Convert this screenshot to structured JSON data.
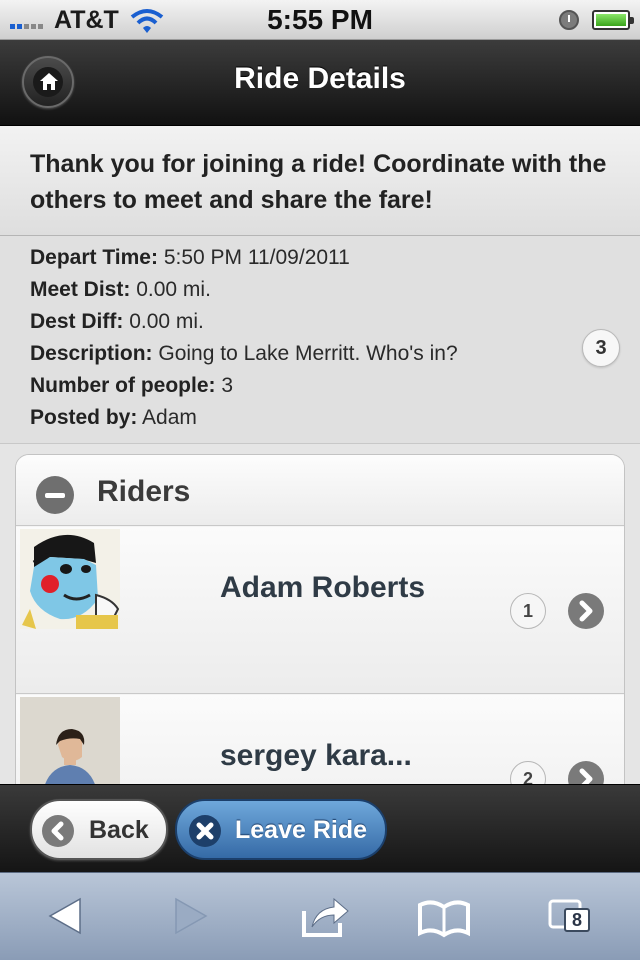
{
  "status_bar": {
    "carrier": "AT&T",
    "time": "5:55 PM"
  },
  "header": {
    "title": "Ride Details",
    "home_icon": "home-icon"
  },
  "banner": {
    "message": "Thank you for joining a ride! Coordinate with the others to meet and share the fare!"
  },
  "details": {
    "depart_label": "Depart Time:",
    "depart_value": "5:50 PM 11/09/2011",
    "meet_label": "Meet Dist:",
    "meet_value": "0.00 mi.",
    "dest_label": "Dest Diff:",
    "dest_value": "0.00 mi.",
    "description_label": "Description:",
    "description_value": "Going to Lake Merritt. Who's in?",
    "people_label": "Number of people:",
    "people_value": "3",
    "posted_label": "Posted by:",
    "posted_value": "Adam",
    "count_badge": "3"
  },
  "riders": {
    "title": "Riders",
    "items": [
      {
        "name": "Adam Roberts",
        "count": "1"
      },
      {
        "name": "sergey kara...",
        "count": "2"
      }
    ]
  },
  "footer": {
    "back_label": "Back",
    "leave_label": "Leave Ride"
  },
  "safari": {
    "tabs_count": "8"
  },
  "colors": {
    "header_dark": "#1f1f1f",
    "leave_blue": "#4a82c1",
    "rider_name": "#2f3b46"
  }
}
